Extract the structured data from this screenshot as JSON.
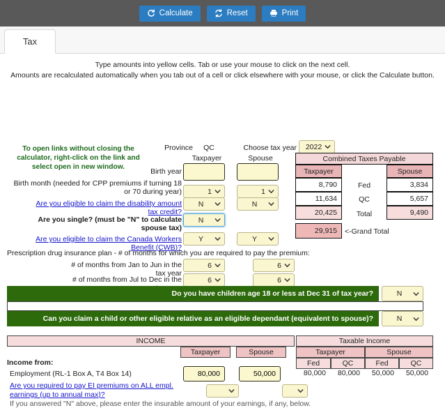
{
  "toolbar": {
    "calculate_label": "Calculate",
    "reset_label": "Reset",
    "print_label": "Print"
  },
  "tabs": [
    {
      "label": "Tax"
    }
  ],
  "intro": {
    "line1": "Type amounts into yellow cells.  Tab or use your mouse to click on the next cell.",
    "line2": "Amounts are recalculated automatically when you tab out of a cell or click elsewhere with your mouse, or click the Calculate button."
  },
  "notice": {
    "text": "To open links without closing the calculator, right-click on the link and select open in new window."
  },
  "header": {
    "province_label": "Province",
    "province_value": "QC",
    "taxpayer_label": "Taxpayer",
    "spouse_label": "Spouse",
    "tax_year_label": "Choose tax year",
    "tax_year_value": "2022"
  },
  "questions": [
    {
      "label": "Birth year",
      "type": "input",
      "link": false,
      "taxpayer": "",
      "spouse": ""
    },
    {
      "label": "Birth month (needed for CPP premiums if turning 18 or 70 during year)",
      "type": "select",
      "link": false,
      "taxpayer": "1",
      "spouse": "1"
    },
    {
      "label": "Are you eligible to claim the disability amount tax credit?",
      "type": "select",
      "link": true,
      "taxpayer": "N",
      "spouse": "N"
    },
    {
      "label": "Are you single? (must be \"N\" to calculate spouse tax)",
      "type": "select",
      "link": false,
      "taxpayer": "N",
      "spouse": null
    },
    {
      "label": "Are you eligible to claim the Canada Workers Benefit (CWB)?",
      "type": "select",
      "link": true,
      "taxpayer": "Y",
      "spouse": "Y"
    }
  ],
  "prescription": {
    "title": "Prescription drug insurance plan - # of months for which you are required to pay the premium:",
    "rows": [
      {
        "label": "# of months from Jan to Jun in the tax year",
        "taxpayer": "6",
        "spouse": "6"
      },
      {
        "label": "# of months from Jul to Dec in the tax year",
        "taxpayer": "6",
        "spouse": "6"
      }
    ]
  },
  "banners": [
    {
      "label": "Do you have children age 18 or less at Dec 31 of tax year?",
      "value": "N"
    },
    {
      "label": "Can you claim a child or other eligible relative as an eligible dependant (equivalent to spouse)?",
      "value": "N"
    }
  ],
  "taxes_payable": {
    "title": "Combined Taxes Payable",
    "col_taxpayer": "Taxpayer",
    "col_spouse": "Spouse",
    "row_fed": "Fed",
    "row_qc": "QC",
    "row_total": "Total",
    "grand_total_label": "<-Grand Total",
    "taxpayer_fed": "8,790",
    "taxpayer_qc": "11,634",
    "taxpayer_total": "20,425",
    "spouse_fed": "3,834",
    "spouse_qc": "5,657",
    "spouse_total": "9,490",
    "grand_total": "29,915"
  },
  "income": {
    "income_header": "INCOME",
    "taxable_header": "Taxable Income",
    "col_taxpayer": "Taxpayer",
    "col_spouse": "Spouse",
    "col_fed": "Fed",
    "col_qc": "QC",
    "income_from_label": "Income from:",
    "employment": {
      "label": "Employment (RL-1 Box A, T4 Box 14)",
      "taxpayer_input": "80,000",
      "spouse_input": "50,000",
      "taxpayer_fed": "80,000",
      "taxpayer_qc": "80,000",
      "spouse_fed": "50,000",
      "spouse_qc": "50,000"
    },
    "ei_question": "Are you required to pay EI premiums on ALL empl. earnings (up to annual max)?",
    "ei_taxpayer": "",
    "ei_spouse": "",
    "footnote": "If you answered \"N\" above, please enter the insurable amount of your earnings, if any, below."
  },
  "colors": {
    "toolbar_bg": "#595959",
    "button_blue": "#2b7cc0",
    "banner_green": "#2d6a0c",
    "yellow_cell": "#fbf8d0",
    "pink_header": "#f4d7d8",
    "pink_header_dark": "#e8b4b6",
    "link_blue": "#1414cc",
    "notice_green": "#1d6b1d"
  }
}
